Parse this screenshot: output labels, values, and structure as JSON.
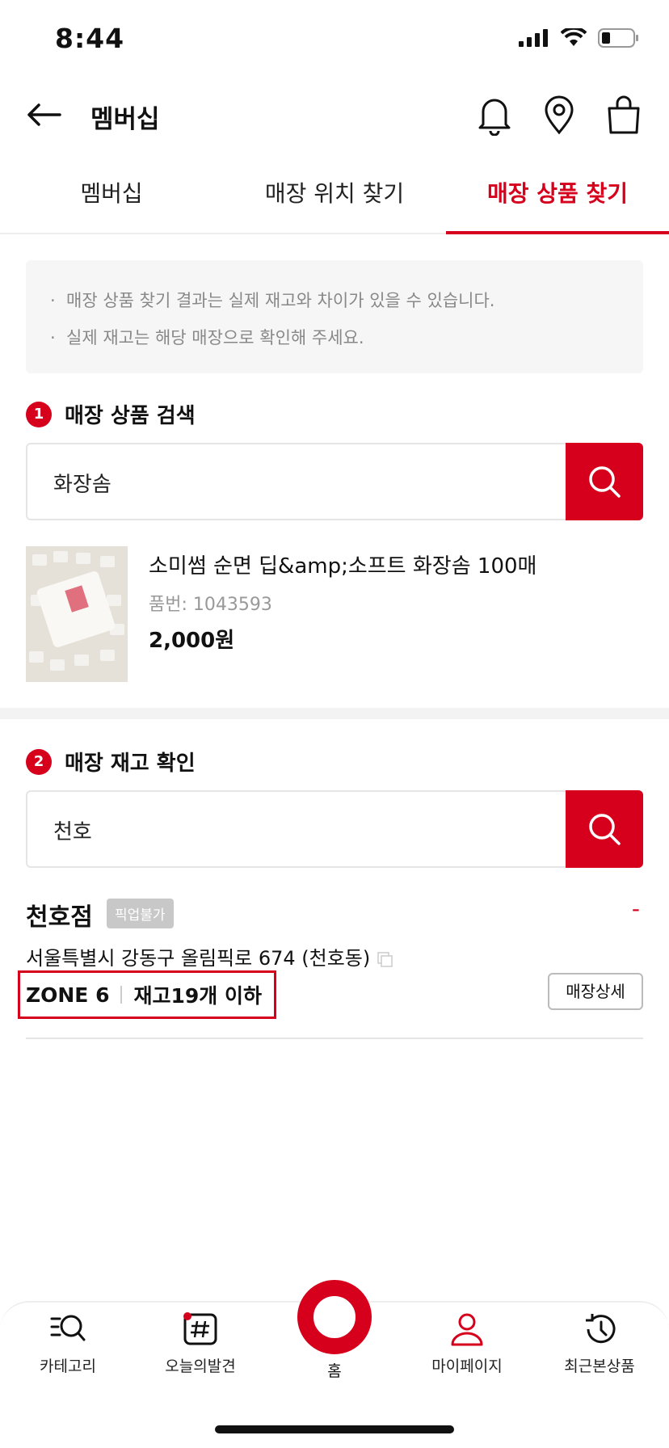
{
  "status": {
    "time": "8:44"
  },
  "header": {
    "title": "멤버십"
  },
  "tabs": [
    {
      "label": "멤버십"
    },
    {
      "label": "매장 위치 찾기"
    },
    {
      "label": "매장 상품 찾기"
    }
  ],
  "notice": {
    "line1": "매장 상품 찾기 결과는 실제 재고와 차이가 있을 수 있습니다.",
    "line2": "실제 재고는 해당 매장으로 확인해 주세요."
  },
  "section1": {
    "number": "1",
    "title": "매장 상품 검색",
    "search_value": "화장솜"
  },
  "product": {
    "name": "소미썸 순면 딥&amp;소프트 화장솜 100매",
    "code": "품번: 1043593",
    "price": "2,000원"
  },
  "section2": {
    "number": "2",
    "title": "매장 재고 확인",
    "search_value": "천호"
  },
  "store": {
    "name": "천호점",
    "badge": "픽업불가",
    "toggle": "-",
    "address": "서울특별시 강동구 올림픽로 674 (천호동)",
    "zone": "ZONE 6",
    "stock": "재고19개 이하",
    "detail_button": "매장상세"
  },
  "tabbar": {
    "category": "카테고리",
    "today": "오늘의발견",
    "home": "홈",
    "mypage": "마이페이지",
    "recent": "최근본상품"
  },
  "colors": {
    "accent": "#d6001c"
  }
}
